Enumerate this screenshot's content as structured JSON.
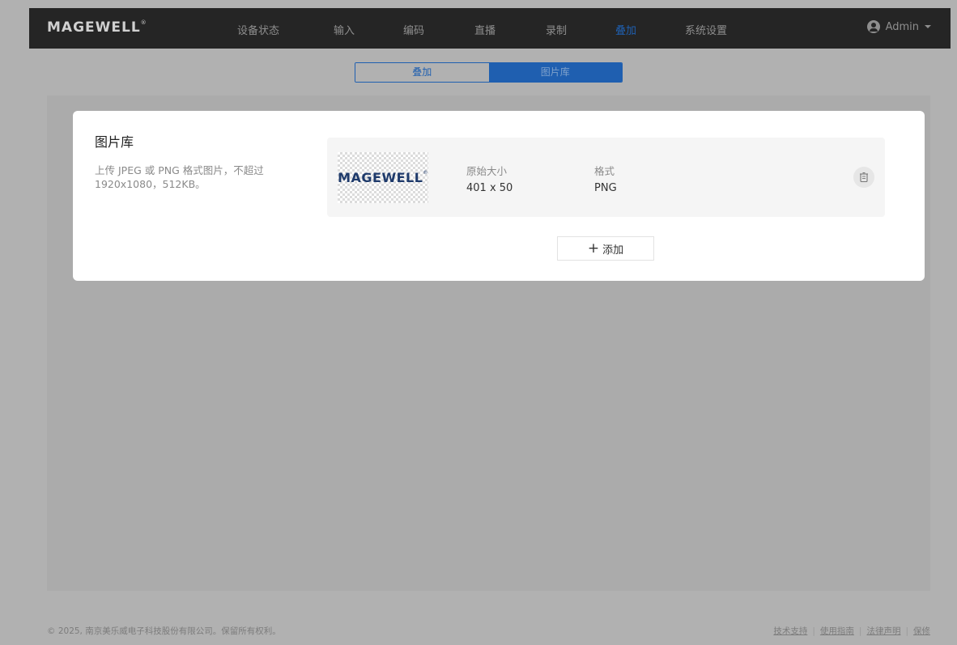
{
  "navbar": {
    "logo": "MAGEWELL",
    "items": [
      {
        "label": "设备状态",
        "active": false
      },
      {
        "label": "输入",
        "active": false
      },
      {
        "label": "编码",
        "active": false
      },
      {
        "label": "直播",
        "active": false
      },
      {
        "label": "录制",
        "active": false
      },
      {
        "label": "叠加",
        "active": true
      },
      {
        "label": "系统设置",
        "active": false
      }
    ],
    "user": "Admin",
    "user_icon": "user-icon"
  },
  "tabs": [
    {
      "label": "叠加",
      "active": false
    },
    {
      "label": "图片库",
      "active": true
    }
  ],
  "library": {
    "title": "图片库",
    "description": "上传 JPEG 或 PNG 格式图片，不超过1920x1080，512KB。",
    "images": [
      {
        "thumbnail_text": "MAGEWELL",
        "size_label": "原始大小",
        "size_value": "401 x 50",
        "format_label": "格式",
        "format_value": "PNG",
        "delete_icon": "trash-icon"
      }
    ],
    "add_label": "添加",
    "add_icon": "plus-icon"
  },
  "footer": {
    "copyright": "© 2025, 南京美乐威电子科技股份有限公司。保留所有权利。",
    "links": [
      "技术支持",
      "使用指南",
      "法律声明",
      "保修"
    ]
  },
  "colors": {
    "accent": "#1f5fb0",
    "navbar_bg": "#252525",
    "overlay_bg": "#b1b1b1"
  }
}
